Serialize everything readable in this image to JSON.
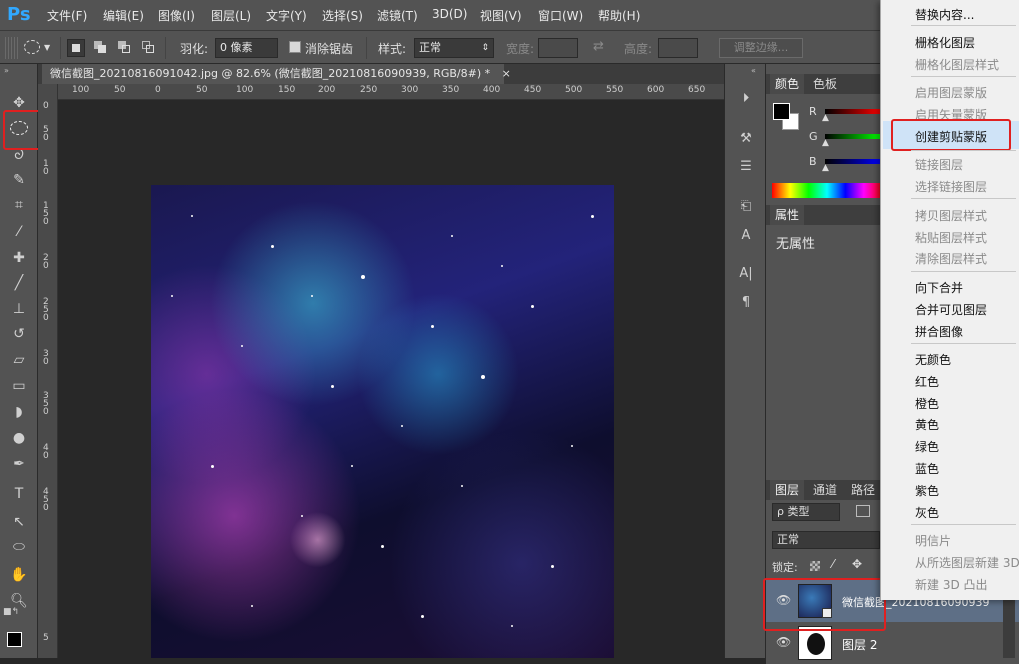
{
  "app": {
    "logo": "Ps"
  },
  "menubar": [
    "文件(F)",
    "编辑(E)",
    "图像(I)",
    "图层(L)",
    "文字(Y)",
    "选择(S)",
    "滤镜(T)",
    "3D(D)",
    "视图(V)",
    "窗口(W)",
    "帮助(H)"
  ],
  "options": {
    "feather_label": "羽化:",
    "feather_value": "0 像素",
    "antialias_label": "消除锯齿",
    "style_label": "样式:",
    "style_value": "正常",
    "width_label": "宽度:",
    "height_label": "高度:",
    "refine_edge": "调整边缘..."
  },
  "document": {
    "tab_title": "微信截图_20210816091042.jpg @ 82.6% (微信截图_20210816090939, RGB/8#) *",
    "close": "×"
  },
  "ruler_h": [
    "100",
    "50",
    "0",
    "50",
    "100",
    "150",
    "200",
    "250",
    "300",
    "350",
    "400",
    "450",
    "500",
    "550",
    "600",
    "650"
  ],
  "ruler_v": [
    "0",
    "5",
    "0",
    "1",
    "0",
    "1",
    "5",
    "0",
    "2",
    "0",
    "2",
    "5",
    "0",
    "3",
    "0",
    "3",
    "5",
    "0",
    "4",
    "0",
    "4",
    "5",
    "0",
    "5"
  ],
  "panels": {
    "color_tab": "颜色",
    "swatches_tab": "色板",
    "channel_r": "R",
    "channel_g": "G",
    "channel_b": "B",
    "properties_tab": "属性",
    "no_properties": "无属性",
    "layers_tab": "图层",
    "channels_tab": "通道",
    "paths_tab": "路径",
    "kind_filter": "ρ 类型",
    "blend_mode": "正常",
    "lock_label": "锁定:",
    "layers": [
      {
        "name": "微信截图_20210816090939"
      },
      {
        "name": "图层 2"
      }
    ]
  },
  "context_menu": [
    {
      "label": "替换内容...",
      "disabled": false
    },
    {
      "label": "栅格化图层",
      "disabled": false
    },
    {
      "label": "栅格化图层样式",
      "disabled": true
    },
    {
      "label": "启用图层蒙版",
      "disabled": true
    },
    {
      "label": "启用矢量蒙版",
      "disabled": true
    },
    {
      "label": "创建剪贴蒙版",
      "disabled": false,
      "highlighted": true
    },
    {
      "label": "链接图层",
      "disabled": true
    },
    {
      "label": "选择链接图层",
      "disabled": true
    },
    {
      "label": "拷贝图层样式",
      "disabled": true
    },
    {
      "label": "粘贴图层样式",
      "disabled": true
    },
    {
      "label": "清除图层样式",
      "disabled": true
    },
    {
      "label": "向下合并",
      "disabled": false
    },
    {
      "label": "合并可见图层",
      "disabled": false
    },
    {
      "label": "拼合图像",
      "disabled": false
    },
    {
      "label": "无颜色",
      "disabled": false
    },
    {
      "label": "红色",
      "disabled": false
    },
    {
      "label": "橙色",
      "disabled": false
    },
    {
      "label": "黄色",
      "disabled": false
    },
    {
      "label": "绿色",
      "disabled": false
    },
    {
      "label": "蓝色",
      "disabled": false
    },
    {
      "label": "紫色",
      "disabled": false
    },
    {
      "label": "灰色",
      "disabled": false
    },
    {
      "label": "明信片",
      "disabled": true
    },
    {
      "label": "从所选图层新建 3D",
      "disabled": true
    },
    {
      "label": "新建 3D 凸出",
      "disabled": true
    }
  ],
  "colors": {
    "accent_highlight": "#cfe3f7",
    "annotation_red": "#e02020",
    "ps_blue": "#31a8ff"
  }
}
